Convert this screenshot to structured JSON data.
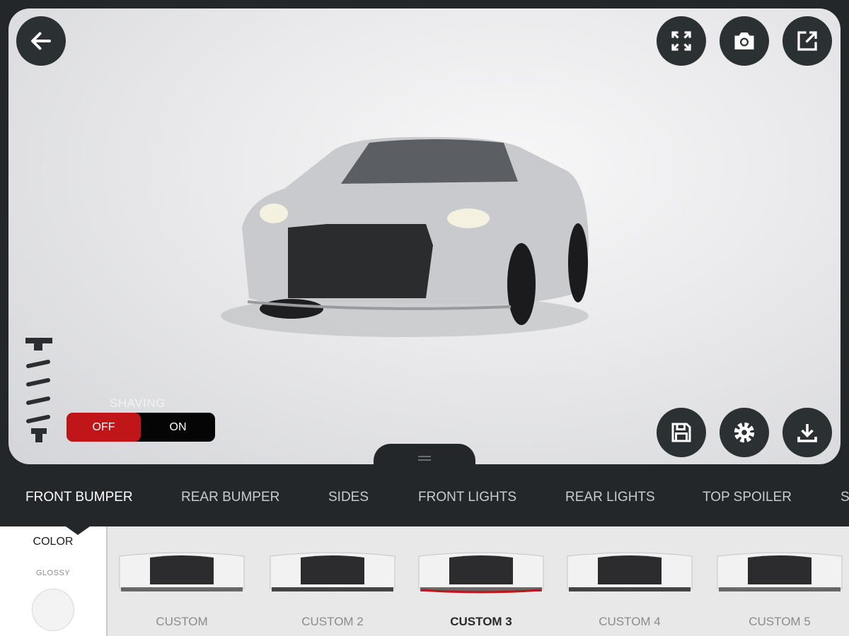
{
  "viewer": {
    "buttons": {
      "back": "arrow-left-icon",
      "fullscreen": "expand-icon",
      "screenshot": "camera-icon",
      "share": "external-link-icon",
      "save": "floppy-disk-icon",
      "settings": "gear-icon",
      "download": "download-icon"
    },
    "shaving": {
      "label": "SHAVING",
      "off": "OFF",
      "on": "ON",
      "value": "OFF"
    },
    "colors": {
      "accent": "#c0161a",
      "dark": "#23272a"
    }
  },
  "tabs": [
    {
      "label": "FRONT BUMPER",
      "active": true
    },
    {
      "label": "REAR BUMPER"
    },
    {
      "label": "SIDES"
    },
    {
      "label": "FRONT LIGHTS"
    },
    {
      "label": "REAR LIGHTS"
    },
    {
      "label": "TOP SPOILER"
    },
    {
      "label": "S"
    }
  ],
  "color_panel": {
    "title": "COLOR",
    "finish": "GLOSSY",
    "swatch": "#f3f3f3"
  },
  "options": [
    {
      "label": "CUSTOM"
    },
    {
      "label": "CUSTOM 2"
    },
    {
      "label": "CUSTOM 3",
      "selected": true
    },
    {
      "label": "CUSTOM 4"
    },
    {
      "label": "CUSTOM 5"
    }
  ]
}
